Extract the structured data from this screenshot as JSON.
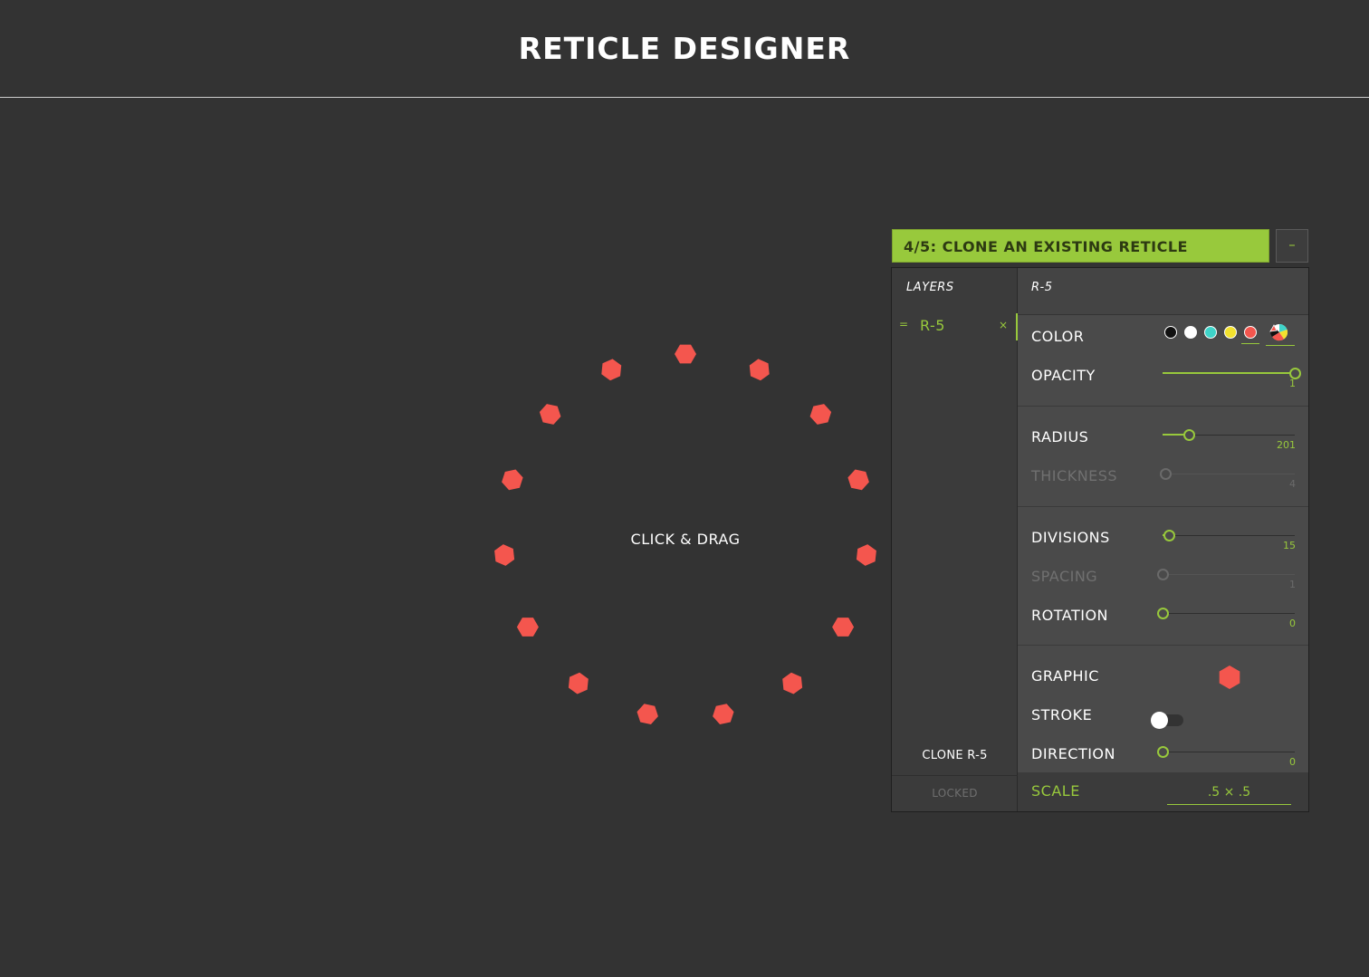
{
  "app": {
    "title": "RETICLE DESIGNER"
  },
  "stage": {
    "hint": "CLICK & DRAG"
  },
  "reticle": {
    "divisions": 15,
    "radius": 201,
    "rotation": 0,
    "graphic": "hexagon",
    "color": "#f4564e",
    "scale": 0.5
  },
  "tutorial": {
    "text": "4/5: CLONE AN EXISTING RETICLE",
    "minimize_label": "–"
  },
  "layers": {
    "heading": "LAYERS",
    "items": [
      {
        "handle": "=",
        "name": "R-5",
        "remove": "×"
      }
    ],
    "clone_label": "CLONE R-5",
    "locked_label": "LOCKED"
  },
  "properties": {
    "title": "R-5",
    "color": {
      "label": "COLOR",
      "swatches": [
        "#111111",
        "#ffffff",
        "#3fd4c9",
        "#f2e12e",
        "#f4564e"
      ],
      "selected_index": 4,
      "picker_icon": "color-wheel-icon"
    },
    "opacity": {
      "label": "OPACITY",
      "value": "1",
      "fraction": 1.0
    },
    "radius": {
      "label": "RADIUS",
      "value": "201",
      "fraction": 0.2
    },
    "thickness": {
      "label": "THICKNESS",
      "value": "4",
      "fraction": 0.02,
      "disabled": true
    },
    "divisions": {
      "label": "DIVISIONS",
      "value": "15",
      "fraction": 0.05
    },
    "spacing": {
      "label": "SPACING",
      "value": "1",
      "fraction": 0.0,
      "disabled": true
    },
    "rotation": {
      "label": "ROTATION",
      "value": "0",
      "fraction": 0.0
    },
    "graphic": {
      "label": "GRAPHIC",
      "icon": "hexagon-icon"
    },
    "stroke": {
      "label": "STROKE",
      "on": false
    },
    "direction": {
      "label": "DIRECTION",
      "value": "0",
      "fraction": 0.0
    },
    "scale": {
      "label": "SCALE",
      "value": ".5 × .5"
    }
  }
}
